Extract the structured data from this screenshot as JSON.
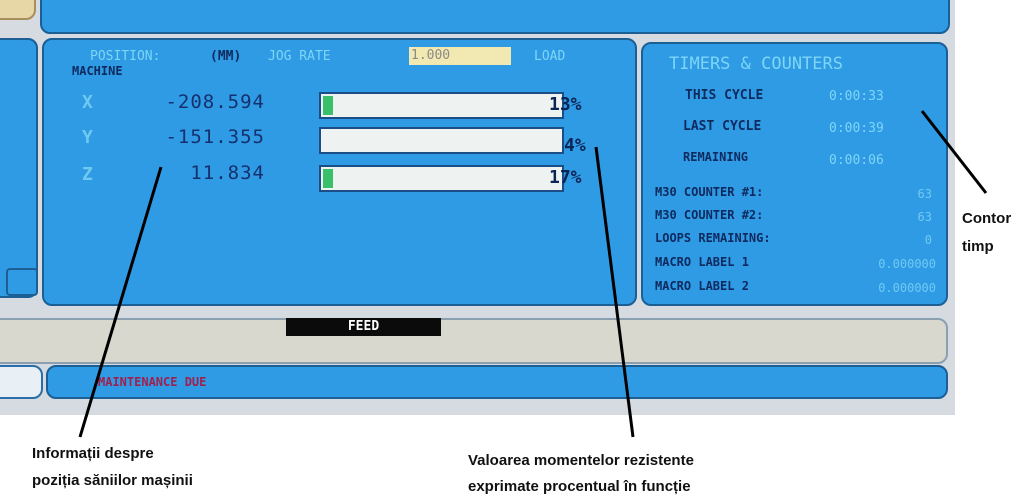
{
  "position": {
    "header": "POSITION:",
    "units": "(MM)",
    "jog_label": "JOG RATE",
    "jog_value": "1.000",
    "load_label": "LOAD",
    "mode": "MACHINE",
    "axes": [
      {
        "axis": "X",
        "value": "-208.594",
        "load": 0.04,
        "load_text": "13%"
      },
      {
        "axis": "Y",
        "value": "-151.355",
        "load": 0.0,
        "load_text": "4%"
      },
      {
        "axis": "Z",
        "value": "11.834",
        "load": 0.04,
        "load_text": "17%"
      }
    ]
  },
  "timers": {
    "title": "TIMERS & COUNTERS",
    "rows": [
      {
        "label": "THIS CYCLE",
        "value": "0:00:33"
      },
      {
        "label": "LAST CYCLE",
        "value": "0:00:39"
      },
      {
        "label": "REMAINING",
        "value": "0:00:06"
      }
    ],
    "counters": [
      {
        "label": "M30 COUNTER #1:",
        "value": "63"
      },
      {
        "label": "M30 COUNTER #2:",
        "value": "63"
      },
      {
        "label": "LOOPS REMAINING:",
        "value": "0"
      },
      {
        "label": "MACRO LABEL 1",
        "value": "0.000000"
      },
      {
        "label": "MACRO LABEL 2",
        "value": "0.000000"
      }
    ]
  },
  "feed": "FEED",
  "status": "MAINTENANCE DUE",
  "annotations": {
    "timer": [
      "Contor",
      "timp"
    ],
    "position": [
      "Informații despre",
      "poziția săniilor mașinii"
    ],
    "load": [
      "Valoarea momentelor rezistente",
      "exprimate procentual în funcție"
    ]
  },
  "colors": {
    "panel": "#2f9be5",
    "panel_border": "#1b5f95",
    "load_fill": "#3ac06a",
    "bar_bg": "#eef3f2",
    "jog_bg": "#f2e9b2"
  }
}
